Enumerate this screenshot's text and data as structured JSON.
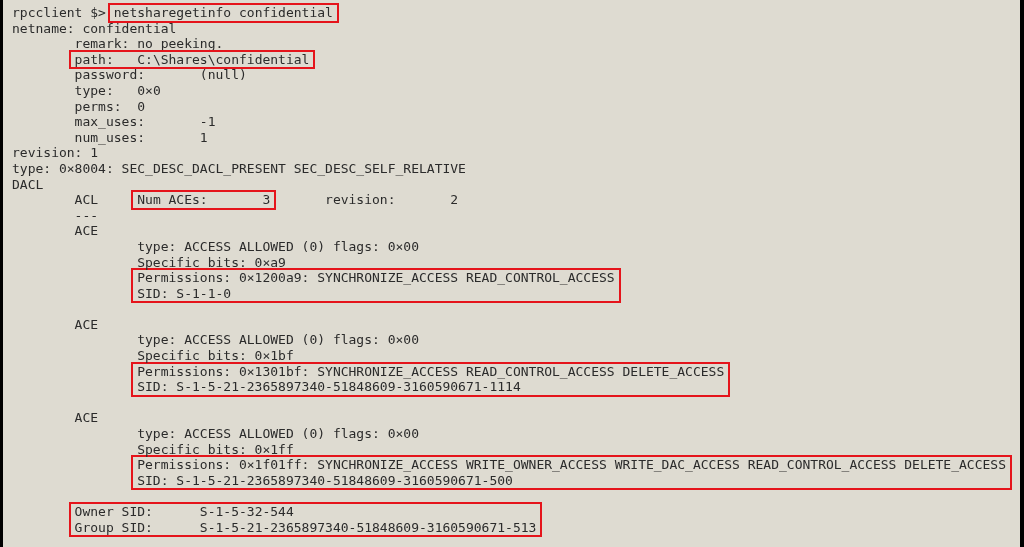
{
  "terminal": {
    "output": [
      {
        "kind": "line",
        "segments": [
          {
            "text": "rpcclient $> ",
            "boxed": false
          },
          {
            "text": "netsharegetinfo confidential",
            "boxed": true
          }
        ]
      },
      {
        "kind": "line",
        "segments": [
          {
            "text": "netname: confidential",
            "boxed": false
          }
        ],
        "children": [
          {
            "kind": "line",
            "segments": [
              {
                "text": "remark: no peeking.",
                "boxed": false
              }
            ]
          },
          {
            "kind": "line",
            "segments": [
              {
                "text": "path:\tC:\\Shares\\confidential",
                "boxed": true
              }
            ]
          },
          {
            "kind": "line",
            "segments": [
              {
                "text": "password:\t(null)",
                "boxed": false
              }
            ]
          },
          {
            "kind": "line",
            "segments": [
              {
                "text": "type:\t0×0",
                "boxed": false
              }
            ]
          },
          {
            "kind": "line",
            "segments": [
              {
                "text": "perms:\t0",
                "boxed": false
              }
            ]
          },
          {
            "kind": "line",
            "segments": [
              {
                "text": "max_uses:\t-1",
                "boxed": false
              }
            ]
          },
          {
            "kind": "line",
            "segments": [
              {
                "text": "num_uses:\t1",
                "boxed": false
              }
            ]
          }
        ]
      },
      {
        "kind": "line",
        "segments": [
          {
            "text": "revision: 1",
            "boxed": false
          }
        ]
      },
      {
        "kind": "line",
        "segments": [
          {
            "text": "type: 0×8004: SEC_DESC_DACL_PRESENT SEC_DESC_SELF_RELATIVE",
            "boxed": false
          }
        ]
      },
      {
        "kind": "line",
        "segments": [
          {
            "text": "DACL",
            "boxed": false
          }
        ],
        "children": [
          {
            "kind": "line",
            "segments": [
              {
                "text": "ACL\t",
                "boxed": false
              },
              {
                "text": "Num ACEs:\t3",
                "boxed": true
              },
              {
                "text": "\trevision:\t2",
                "boxed": false
              }
            ]
          },
          {
            "kind": "line",
            "segments": [
              {
                "text": "---",
                "boxed": false
              }
            ]
          },
          {
            "kind": "line",
            "segments": [
              {
                "text": "ACE",
                "boxed": false
              }
            ],
            "children": [
              {
                "kind": "line",
                "segments": [
                  {
                    "text": "type: ACCESS ALLOWED (0) flags: 0×00",
                    "boxed": false
                  }
                ]
              },
              {
                "kind": "line",
                "segments": [
                  {
                    "text": "Specific bits: 0×a9",
                    "boxed": false
                  }
                ]
              },
              {
                "kind": "box",
                "lines": [
                  "Permissions: 0×1200a9: SYNCHRONIZE_ACCESS READ_CONTROL_ACCESS",
                  "SID: S-1-1-0"
                ]
              }
            ]
          },
          {
            "kind": "blank"
          },
          {
            "kind": "line",
            "segments": [
              {
                "text": "ACE",
                "boxed": false
              }
            ],
            "children": [
              {
                "kind": "line",
                "segments": [
                  {
                    "text": "type: ACCESS ALLOWED (0) flags: 0×00",
                    "boxed": false
                  }
                ]
              },
              {
                "kind": "line",
                "segments": [
                  {
                    "text": "Specific bits: 0×1bf",
                    "boxed": false
                  }
                ]
              },
              {
                "kind": "box",
                "lines": [
                  "Permissions: 0×1301bf: SYNCHRONIZE_ACCESS READ_CONTROL_ACCESS DELETE_ACCESS",
                  "SID: S-1-5-21-2365897340-51848609-3160590671-1114"
                ]
              }
            ]
          },
          {
            "kind": "blank"
          },
          {
            "kind": "line",
            "segments": [
              {
                "text": "ACE",
                "boxed": false
              }
            ],
            "children": [
              {
                "kind": "line",
                "segments": [
                  {
                    "text": "type: ACCESS ALLOWED (0) flags: 0×00",
                    "boxed": false
                  }
                ]
              },
              {
                "kind": "line",
                "segments": [
                  {
                    "text": "Specific bits: 0×1ff",
                    "boxed": false
                  }
                ]
              },
              {
                "kind": "box",
                "lines": [
                  "Permissions: 0×1f01ff: SYNCHRONIZE_ACCESS WRITE_OWNER_ACCESS WRITE_DAC_ACCESS READ_CONTROL_ACCESS DELETE_ACCESS",
                  "SID: S-1-5-21-2365897340-51848609-3160590671-500"
                ]
              }
            ]
          },
          {
            "kind": "blank"
          },
          {
            "kind": "box",
            "lines": [
              "Owner SID:\tS-1-5-32-544",
              "Group SID:\tS-1-5-21-2365897340-51848609-3160590671-513"
            ]
          }
        ]
      }
    ]
  }
}
